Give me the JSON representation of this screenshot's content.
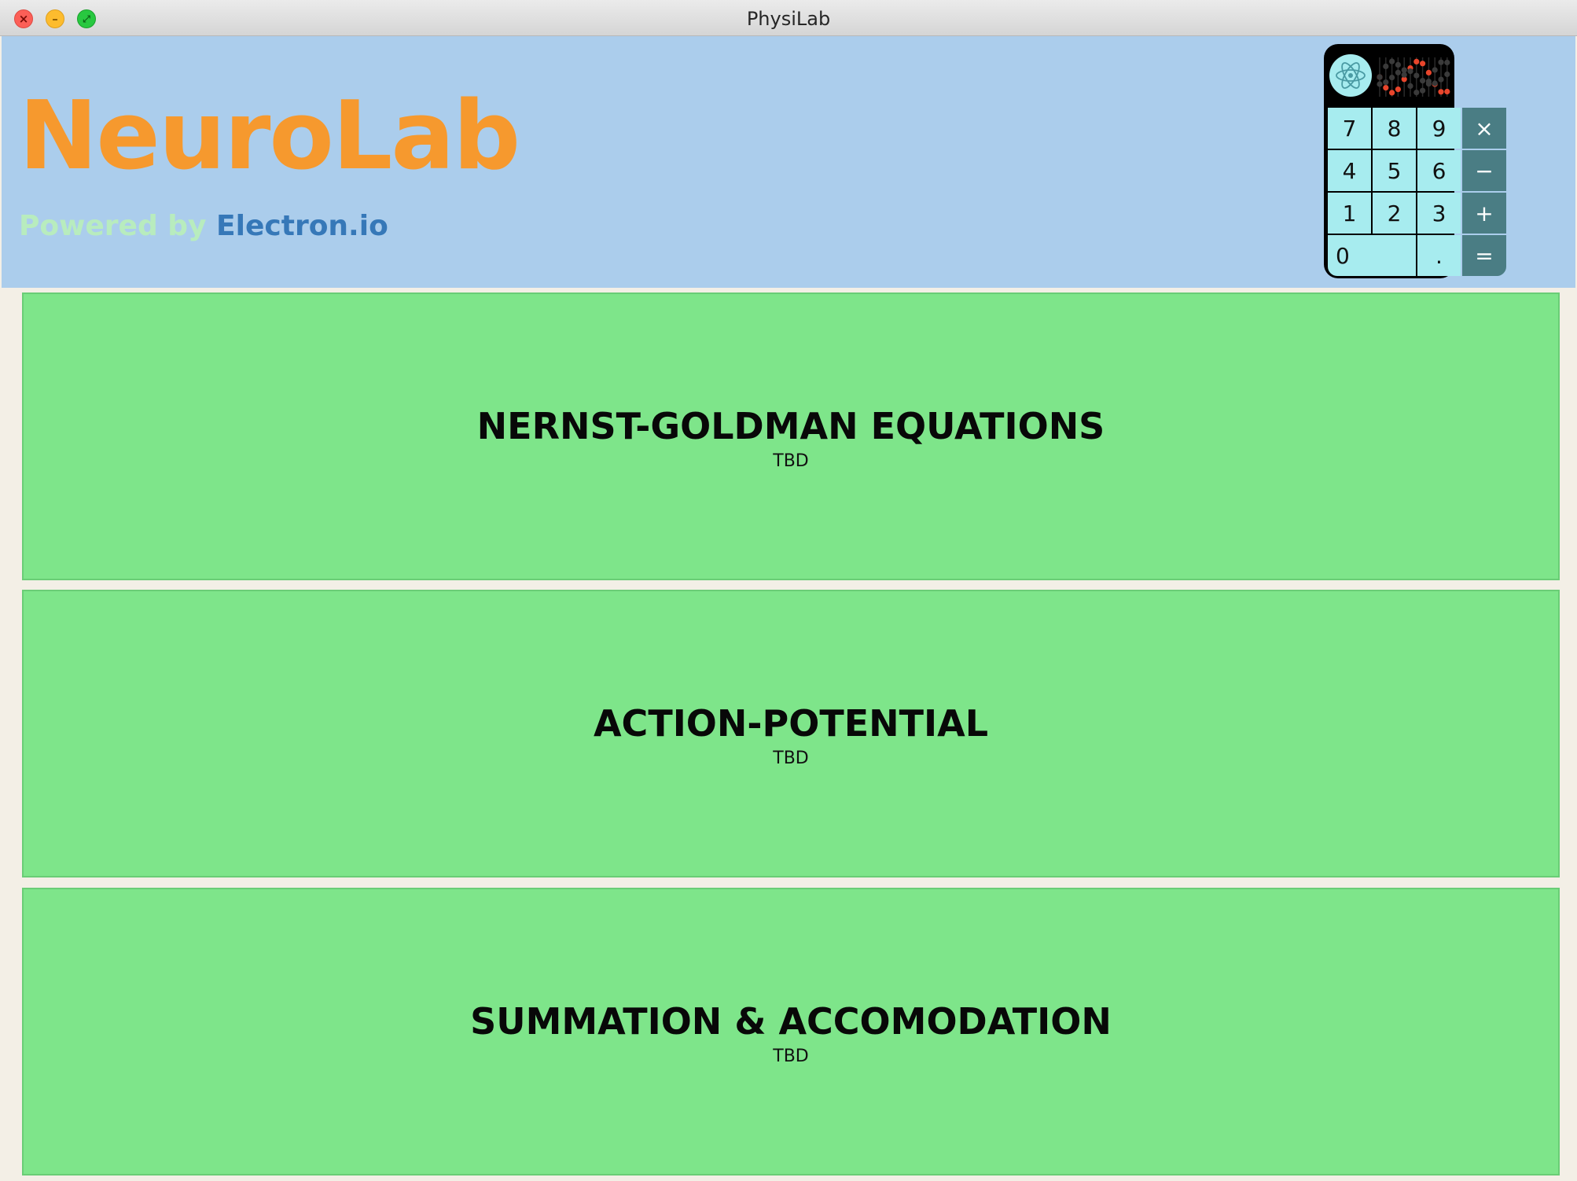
{
  "window": {
    "title": "PhysiLab",
    "controls": {
      "close": "×",
      "minimize": "–",
      "maximize": "⤢"
    }
  },
  "header": {
    "app_name": "NeuroLab",
    "powered_by_prefix": "Powered by ",
    "powered_by_link": "Electron.io",
    "colors": {
      "background": "#abcdec",
      "title": "#f6992e",
      "powered_by": "#b8ecbe",
      "link": "#3678b8"
    }
  },
  "calculator": {
    "logo_icon": "atom-icon",
    "display_icon": "dna-helix-icon",
    "keys": [
      {
        "label": "7",
        "kind": "digit"
      },
      {
        "label": "8",
        "kind": "digit"
      },
      {
        "label": "9",
        "kind": "digit"
      },
      {
        "label": "×",
        "kind": "op"
      },
      {
        "label": "4",
        "kind": "digit"
      },
      {
        "label": "5",
        "kind": "digit"
      },
      {
        "label": "6",
        "kind": "digit"
      },
      {
        "label": "−",
        "kind": "op"
      },
      {
        "label": "1",
        "kind": "digit"
      },
      {
        "label": "2",
        "kind": "digit"
      },
      {
        "label": "3",
        "kind": "digit"
      },
      {
        "label": "+",
        "kind": "op"
      },
      {
        "label": "0",
        "kind": "zero"
      },
      {
        "label": ".",
        "kind": "digit"
      },
      {
        "label": "=",
        "kind": "op-eq"
      }
    ],
    "colors": {
      "key": "#a7ecef",
      "op_key": "#4a7d84",
      "bead_red": "#e8452b",
      "bead_dark": "#3a3a3a"
    }
  },
  "modules": [
    {
      "title": "NERNST-GOLDMAN EQUATIONS",
      "subtitle": "TBD"
    },
    {
      "title": "ACTION-POTENTIAL",
      "subtitle": "TBD"
    },
    {
      "title": "SUMMATION & ACCOMODATION",
      "subtitle": "TBD"
    }
  ],
  "colors": {
    "module_background": "#7ee58a",
    "page_background": "#f3efe6"
  }
}
